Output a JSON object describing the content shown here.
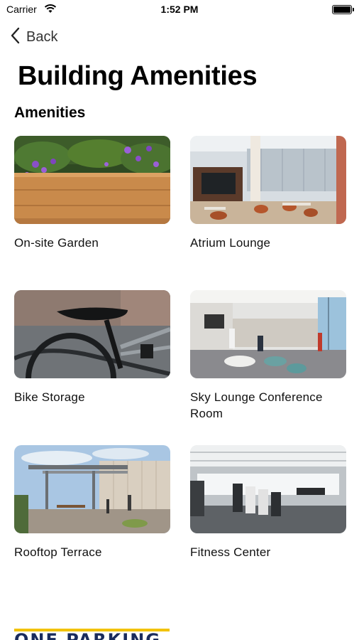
{
  "status_bar": {
    "carrier": "Carrier",
    "time": "1:52 PM",
    "wifi_icon": "wifi-icon",
    "battery_icon": "battery-icon"
  },
  "nav": {
    "back_label": "Back",
    "back_icon": "chevron-left-icon"
  },
  "page_title": "Building Amenities",
  "section_title": "Amenities",
  "amenities": [
    {
      "label": "On-site Garden"
    },
    {
      "label": "Atrium Lounge"
    },
    {
      "label": "Bike Storage"
    },
    {
      "label": "Sky Lounge Conference Room"
    },
    {
      "label": "Rooftop Terrace"
    },
    {
      "label": "Fitness Center"
    }
  ],
  "footer_logo": {
    "text": "ONE PARKING",
    "accent_color": "#f2c200",
    "brand_color": "#1a2b5c"
  }
}
